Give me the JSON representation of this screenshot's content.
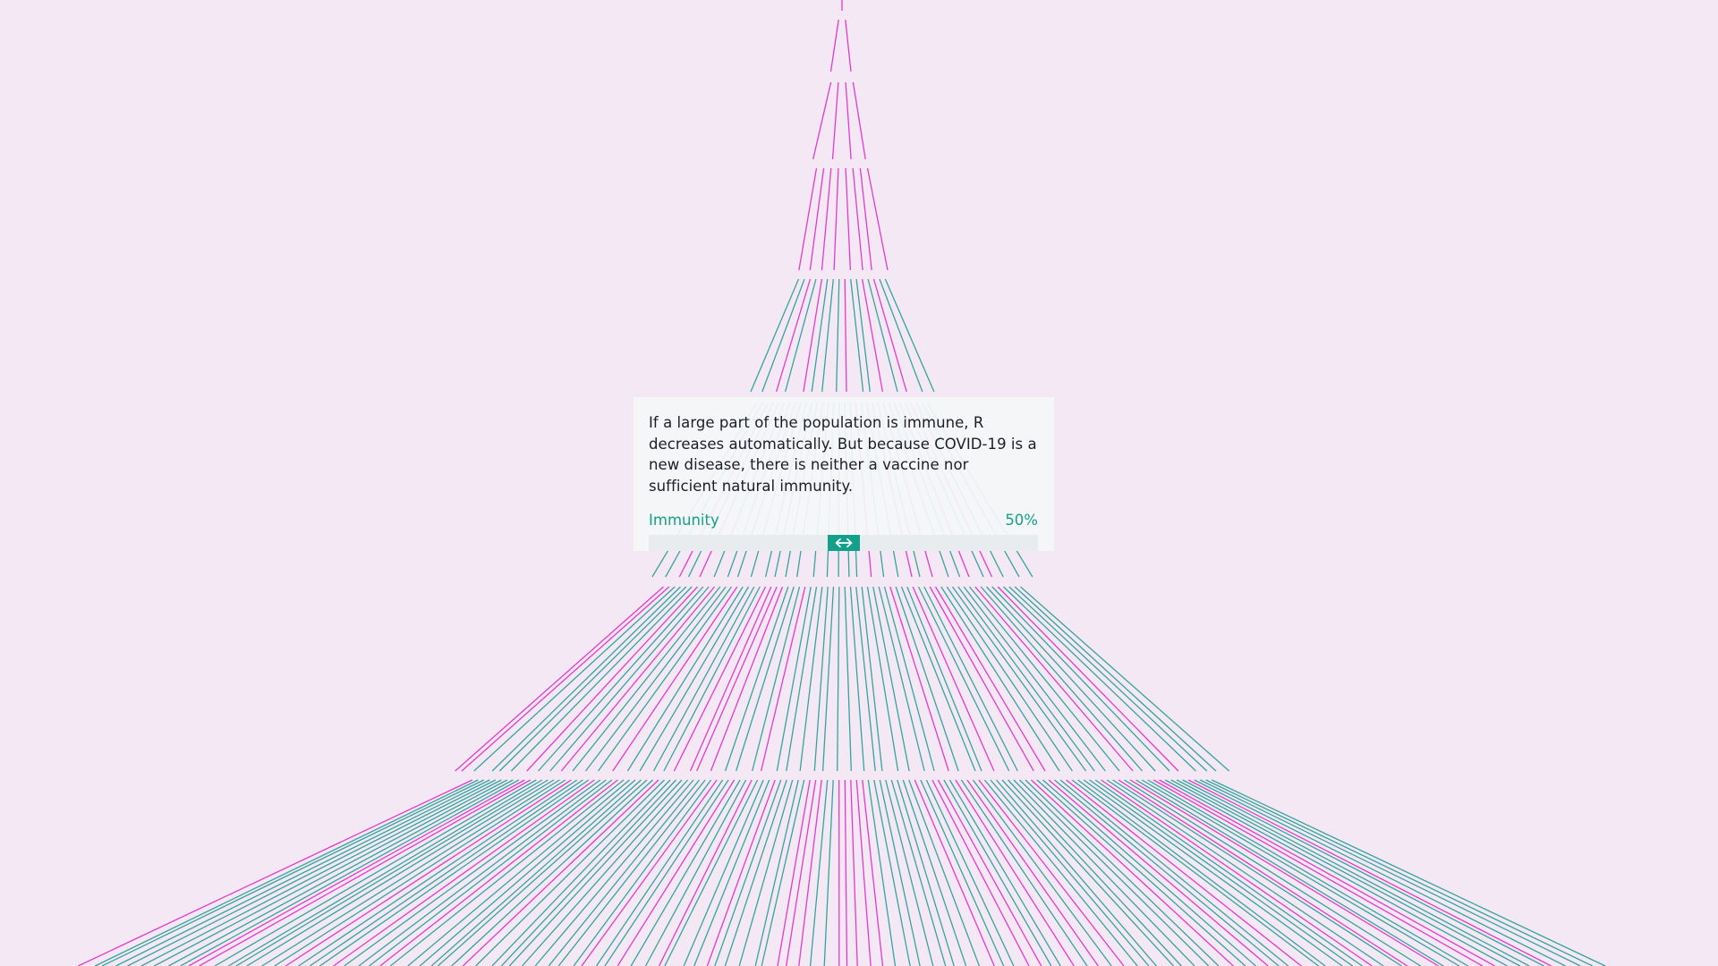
{
  "colors": {
    "background": "#f4e8f4",
    "accent": "#13a08a",
    "teal_line": "#1f9c94",
    "magenta_line": "#e028c8"
  },
  "info_panel": {
    "text": "If a large part of the population is immune, R decreases automatically. But because COVID-19 is a new disease, there is neither a vaccine nor sufficient natural immunity."
  },
  "immunity_slider": {
    "label": "Immunity",
    "value_text": "50%",
    "value": 0.5,
    "thumb_icon": "left-right-arrow-icon"
  },
  "infection_tree": {
    "generations": [
      {
        "cases": 1,
        "immune_fraction": 0
      },
      {
        "cases": 2,
        "immune_fraction": 0
      },
      {
        "cases": 4,
        "immune_fraction": 0
      },
      {
        "cases": 8,
        "immune_fraction": 0
      },
      {
        "cases": 16,
        "immune_fraction": 0.5
      },
      {
        "cases": 32,
        "immune_fraction": 0.5
      },
      {
        "cases": 64,
        "immune_fraction": 0.5
      },
      {
        "cases": 128,
        "immune_fraction": 0.5
      }
    ]
  }
}
